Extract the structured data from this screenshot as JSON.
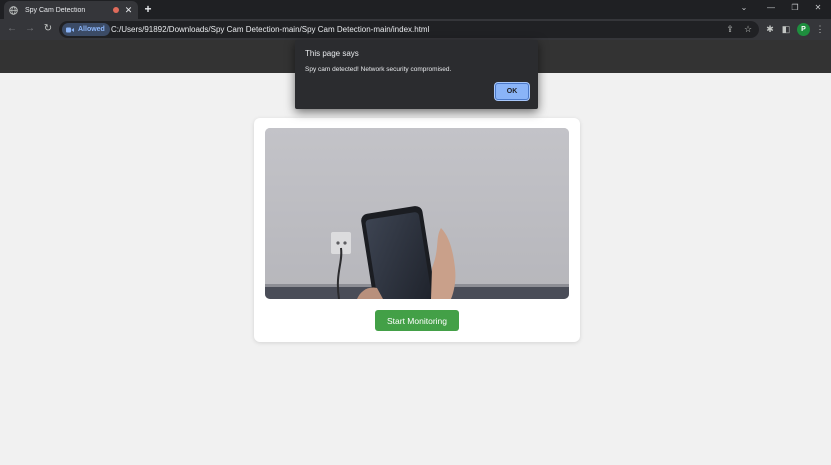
{
  "browser": {
    "tab": {
      "title": "Spy Cam Detection",
      "close": "✕"
    },
    "new_tab": "+",
    "window_controls": {
      "dropdown": "⌄",
      "minimize": "—",
      "restore": "❐",
      "close": "✕"
    },
    "nav": {
      "back": "←",
      "forward": "→",
      "reload": "↻"
    },
    "permission_chip": "Allowed",
    "url": "C:/Users/91892/Downloads/Spy Cam Detection-main/Spy Cam Detection-main/index.html",
    "toolbar_icons": {
      "share": "⇪",
      "bookmark": "☆",
      "extensions": "✱",
      "sidebar": "◧",
      "menu": "⋮"
    },
    "profile_initial": "P"
  },
  "dialog": {
    "title": "This page says",
    "message": "Spy cam detected! Network security compromised.",
    "ok_label": "OK"
  },
  "main": {
    "start_button": "Start Monitoring"
  },
  "colors": {
    "page_bg": "#f1f1f1",
    "header_bg": "#333333",
    "button_green": "#43a047",
    "dialog_bg": "#2b2c2f",
    "dialog_button": "#8ab4f8"
  }
}
